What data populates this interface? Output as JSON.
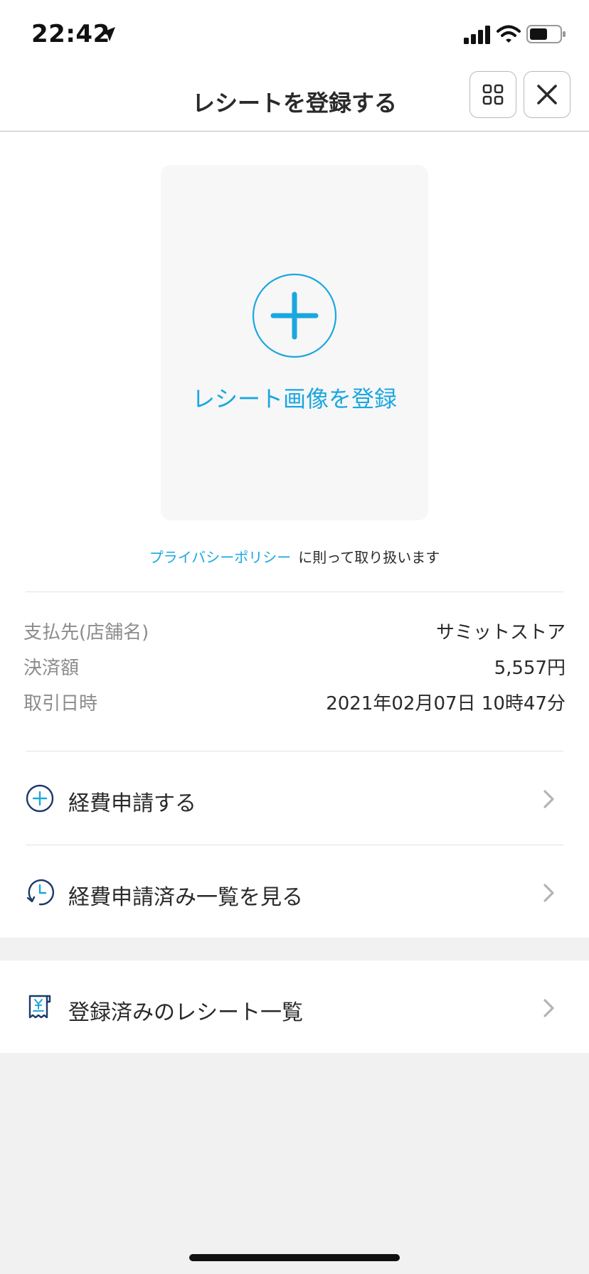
{
  "status_bar": {
    "time": "22:42",
    "icons": [
      "location-arrow-icon",
      "cellular-signal-icon",
      "wifi-icon",
      "battery-icon"
    ]
  },
  "nav": {
    "title": "レシートを登録する",
    "grid_icon": "grid-icon",
    "close_icon": "close-icon"
  },
  "upload": {
    "label": "レシート画像を登録",
    "icon": "plus-circle-icon",
    "accent_color": "#1aa7e0"
  },
  "privacy": {
    "link": "プライバシーポリシー",
    "text": "に則って取り扱います"
  },
  "details": [
    {
      "label": "支払先(店舗名)",
      "value": "サミットストア"
    },
    {
      "label": "決済額",
      "value": "5,557円"
    },
    {
      "label": "取引日時",
      "value": "2021年02月07日 10時47分"
    }
  ],
  "menu": {
    "apply": {
      "label": "経費申請する",
      "icon": "plus-circle-icon"
    },
    "history": {
      "label": "経費申請済み一覧を見る",
      "icon": "clock-history-icon"
    },
    "receipts": {
      "label": "登録済みのレシート一覧",
      "icon": "receipt-yen-icon"
    },
    "chevron_icon": "chevron-right-icon"
  },
  "colors": {
    "accent_blue": "#1aa7e0",
    "navy": "#1b3a6b",
    "label_gray": "#8c8c8c",
    "background_gray": "#f1f1f1"
  }
}
